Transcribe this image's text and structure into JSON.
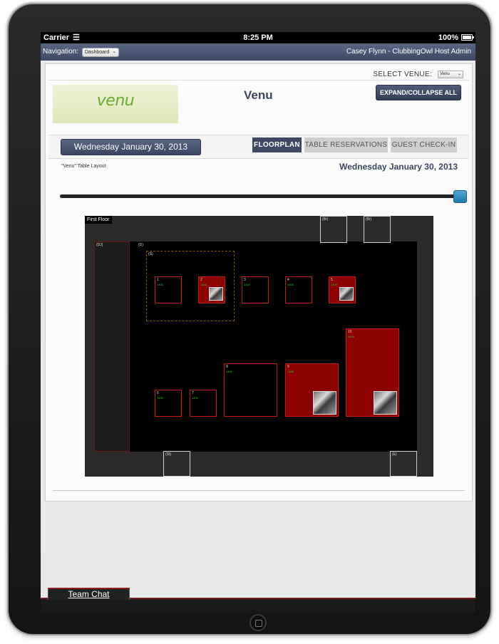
{
  "status_bar": {
    "carrier": "Carrier",
    "time": "8:25 PM",
    "battery": "100%"
  },
  "nav": {
    "label": "Navigation:",
    "selected": "Dashboard",
    "user": "Casey Flynn - ClubbingOwl Host Admin"
  },
  "venue_select": {
    "label": "SELECT VENUE:",
    "value": "Venu"
  },
  "header": {
    "logo_text": "venu",
    "title": "Venu",
    "expand_button": "EXPAND/COLLAPSE ALL"
  },
  "date_button": "Wednesday January 30, 2013",
  "tabs": [
    {
      "label": "FLOORPLAN",
      "active": true
    },
    {
      "label": "TABLE RESERVATIONS",
      "active": false
    },
    {
      "label": "GUEST CHECK-IN",
      "active": false
    }
  ],
  "layout": {
    "label": "\"Venu\" Table Layout",
    "date": "Wednesday January 30, 2013",
    "slider_value": 1.0
  },
  "floor": {
    "name": "First Floor",
    "zones": {
      "br1": "(Br)",
      "br2": "(Br)",
      "dj": "(DJ)",
      "dance": "(D)",
      "s": "(S)",
      "st": "(St)",
      "e": "(E)"
    },
    "tables": [
      {
        "num": "1",
        "price": "1400",
        "reserved": false
      },
      {
        "num": "2",
        "price": "1400",
        "reserved": true
      },
      {
        "num": "3",
        "price": "1400",
        "reserved": false
      },
      {
        "num": "4",
        "price": "1400",
        "reserved": false
      },
      {
        "num": "5",
        "price": "1400",
        "reserved": true
      },
      {
        "num": "6",
        "price": "1400",
        "reserved": false
      },
      {
        "num": "7",
        "price": "1400",
        "reserved": false
      },
      {
        "num": "8",
        "price": "1400",
        "reserved": false
      },
      {
        "num": "9",
        "price": "1400",
        "reserved": true
      },
      {
        "num": "10",
        "price": "1400",
        "reserved": true
      }
    ]
  },
  "team_chat": "Team Chat",
  "colors": {
    "nav_bar": "#4b5775",
    "reserved": "#8b0000",
    "accent_blue": "#2a86bd",
    "table_border": "#c01a1a"
  }
}
